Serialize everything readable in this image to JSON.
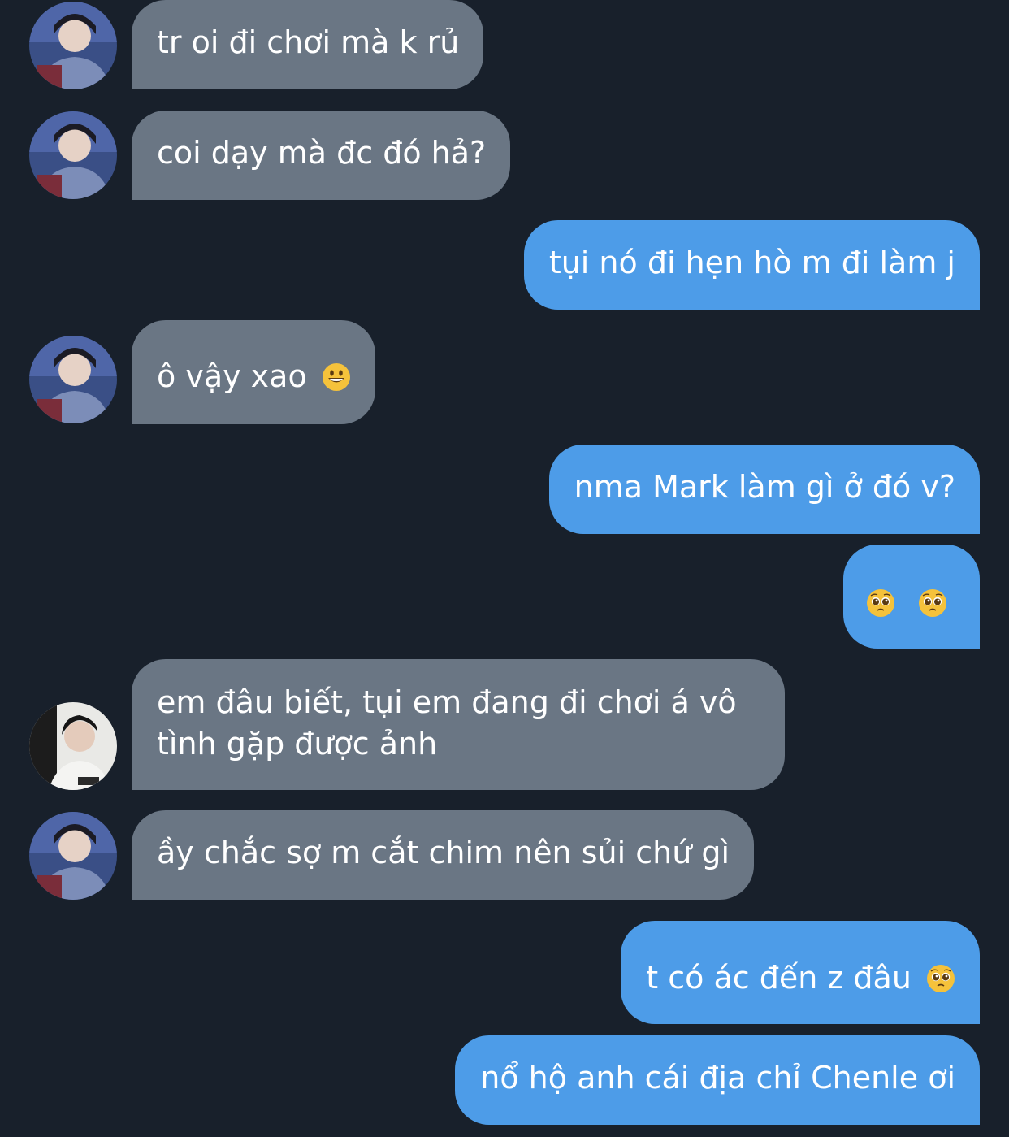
{
  "messages": [
    {
      "sender": "other",
      "text": "tr oi đi chơi mà k rủ"
    },
    {
      "sender": "other",
      "text": "coi dạy mà đc đó hả?"
    },
    {
      "sender": "me",
      "text": "tụi nó đi hẹn hò m đi làm j"
    },
    {
      "sender": "other",
      "text": "ô vậy xao",
      "emoji": "grinning-face-emoji"
    },
    {
      "sender": "me",
      "text": "nma Mark làm gì ở đó v?"
    },
    {
      "sender": "me",
      "text": "",
      "emoji": "pleading-face-emoji ×2"
    },
    {
      "sender": "other2",
      "text": "em đâu biết, tụi em đang đi chơi á vô tình gặp được ảnh"
    },
    {
      "sender": "other",
      "text": "ầy chắc sợ m cắt chim nên sủi chứ gì"
    },
    {
      "sender": "me",
      "text": "t có ác đến z đâu",
      "emoji": "pleading-face-emoji"
    },
    {
      "sender": "me",
      "text": "nổ hộ anh cái địa chỉ Chenle ơi"
    }
  ],
  "colors": {
    "background": "#18202b",
    "incoming_bubble": "#6a7684",
    "outgoing_bubble": "#4d9ce8",
    "text": "#ffffff"
  }
}
